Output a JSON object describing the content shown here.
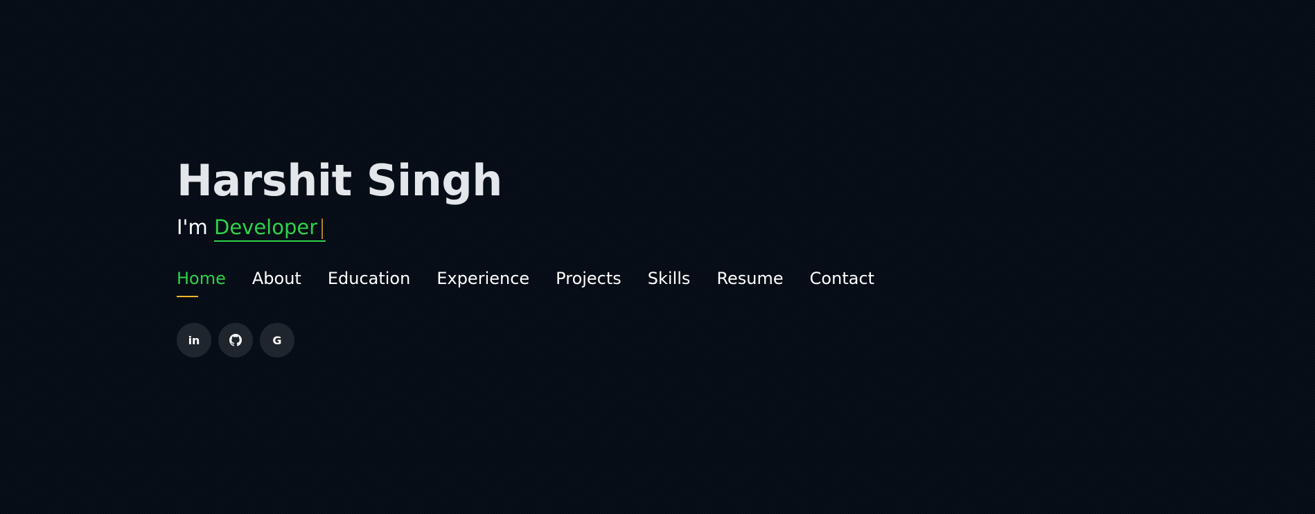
{
  "hero": {
    "name": "Harshit Singh",
    "tagline_prefix": "I'm ",
    "typed_text": "Developer",
    "cursor": "|"
  },
  "nav": {
    "items": [
      {
        "label": "Home",
        "active": true
      },
      {
        "label": "About",
        "active": false
      },
      {
        "label": "Education",
        "active": false
      },
      {
        "label": "Experience",
        "active": false
      },
      {
        "label": "Projects",
        "active": false
      },
      {
        "label": "Skills",
        "active": false
      },
      {
        "label": "Resume",
        "active": false
      },
      {
        "label": "Contact",
        "active": false
      }
    ]
  },
  "socials": [
    {
      "icon": "linkedin-icon",
      "glyph": "in"
    },
    {
      "icon": "github-icon",
      "glyph": ""
    },
    {
      "icon": "google-icon",
      "glyph": "G"
    }
  ],
  "colors": {
    "background": "#040b14",
    "accent_green": "#2fd24a",
    "accent_yellow": "#ffb727",
    "name_text": "#e3e6ea"
  }
}
